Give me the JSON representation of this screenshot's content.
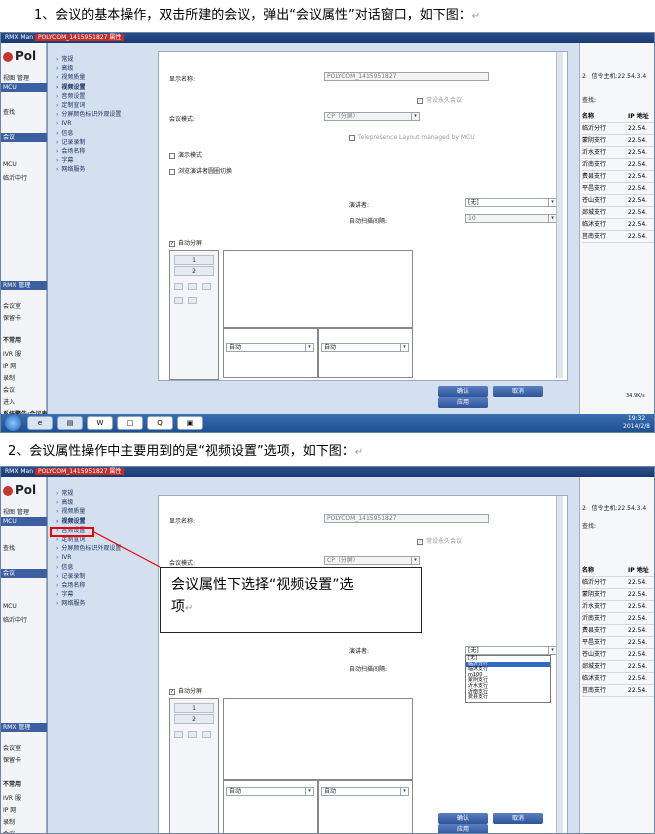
{
  "doc": {
    "step1": "1、会议的基本操作，双击所建的会议，弹出“会议属性”对话窗口，如下图：",
    "step2": "2、会议属性操作中主要用到的是“视频设置”选项，如下图：",
    "return_mark": "↵",
    "callout_line1": "会议属性下选择“视频设置”选",
    "callout_line2": "项"
  },
  "app": {
    "window_title": "RMX Man",
    "dialog_title": "POLYCOM_1415951827",
    "dialog_title_suffix": "属性",
    "logo": "Pol",
    "left_items": [
      "视图",
      "管理",
      "MCU",
      "会议",
      "查找",
      "临沂中行",
      "RMX 管理",
      "会议室",
      "保留卡",
      "不常用",
      "IVR 服",
      "IP 网",
      "录制",
      "会议",
      "进入"
    ],
    "bottom_status": "系统警告:会议表"
  },
  "menu": {
    "items": [
      "常规",
      "高级",
      "视频质量",
      "视频设置",
      "音频设置",
      "定制宣词",
      "分屏颜色标识外观设置",
      "IVR",
      "信息",
      "记录录制",
      "会场名称",
      "字幕",
      "网络服务"
    ],
    "selected_index": 3
  },
  "form": {
    "display_name_label": "显示名称:",
    "display_name_value": "POLYCOM_1415951827",
    "permanent_label": "常设永久会议",
    "conf_mode_label": "会议模式:",
    "conf_mode_value": "CP（分屏）",
    "telepresence_label": "Telepresence Layout managed by MCU",
    "presentation_label": "演示模式",
    "browse_label": "浏览演讲者圆圈切换",
    "speaker_label": "演讲者:",
    "speaker_value": "[无]",
    "auto_scan_label": "自动扫描间隔:",
    "auto_scan_value": "10",
    "auto_layout_label": "自动分屏",
    "tile1": "1",
    "tile2": "2",
    "dropdown_auto": "自动"
  },
  "buttons": {
    "ok": "确认",
    "cancel": "取消",
    "apply": "应用"
  },
  "dropdown": {
    "items": [
      "[无]",
      "临沂分行",
      "临沭支行",
      "m100",
      "蒙阴支行",
      "沂水支行",
      "沂南支行",
      "费县支行"
    ],
    "highlighted_index": 1
  },
  "right_panel": {
    "top_number": "2",
    "signal_label": "信令主机:",
    "signal_value": "22.54.3.4",
    "search_label": "查找:",
    "col_name": "名称",
    "col_ip": "IP 地址",
    "rows": [
      {
        "name": "临沂分行",
        "ip": "22.54."
      },
      {
        "name": "蒙阴支行",
        "ip": "22.54."
      },
      {
        "name": "沂水支行",
        "ip": "22.54."
      },
      {
        "name": "沂南支行",
        "ip": "22.54."
      },
      {
        "name": "费县支行",
        "ip": "22.54."
      },
      {
        "name": "平邑支行",
        "ip": "22.54."
      },
      {
        "name": "苍山支行",
        "ip": "22.54."
      },
      {
        "name": "郯城支行",
        "ip": "22.54."
      },
      {
        "name": "临沭支行",
        "ip": "22.54."
      },
      {
        "name": "莒南支行",
        "ip": "22.54."
      }
    ]
  },
  "taskbar": {
    "time": "19:32",
    "date": "2014/2/8",
    "net_speed": "34.9K/s"
  }
}
